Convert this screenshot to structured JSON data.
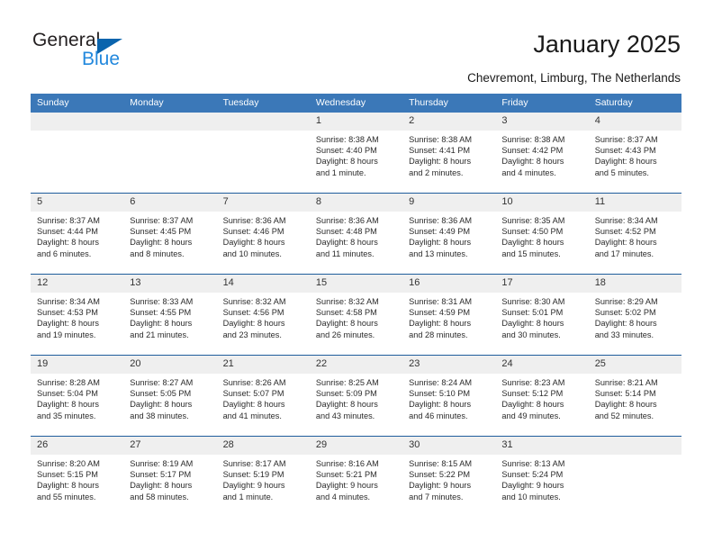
{
  "brand": {
    "name_top": "General",
    "name_bottom": "Blue",
    "accent_color": "#0a64ad",
    "accent_light": "#2288dd"
  },
  "header": {
    "title": "January 2025",
    "subtitle": "Chevremont, Limburg, The Netherlands"
  },
  "theme": {
    "header_row_bg": "#3b78b8",
    "row_divider": "#1f5d9c",
    "daynum_bg": "#efefef",
    "text": "#2b2b2b"
  },
  "weekday_headers": [
    "Sunday",
    "Monday",
    "Tuesday",
    "Wednesday",
    "Thursday",
    "Friday",
    "Saturday"
  ],
  "weeks": [
    [
      {
        "day": "",
        "empty": true,
        "sunrise": "",
        "sunset": "",
        "daylight_line1": "",
        "daylight_line2": ""
      },
      {
        "day": "",
        "empty": true,
        "sunrise": "",
        "sunset": "",
        "daylight_line1": "",
        "daylight_line2": ""
      },
      {
        "day": "",
        "empty": true,
        "sunrise": "",
        "sunset": "",
        "daylight_line1": "",
        "daylight_line2": ""
      },
      {
        "day": "1",
        "empty": false,
        "sunrise": "Sunrise: 8:38 AM",
        "sunset": "Sunset: 4:40 PM",
        "daylight_line1": "Daylight: 8 hours",
        "daylight_line2": "and 1 minute."
      },
      {
        "day": "2",
        "empty": false,
        "sunrise": "Sunrise: 8:38 AM",
        "sunset": "Sunset: 4:41 PM",
        "daylight_line1": "Daylight: 8 hours",
        "daylight_line2": "and 2 minutes."
      },
      {
        "day": "3",
        "empty": false,
        "sunrise": "Sunrise: 8:38 AM",
        "sunset": "Sunset: 4:42 PM",
        "daylight_line1": "Daylight: 8 hours",
        "daylight_line2": "and 4 minutes."
      },
      {
        "day": "4",
        "empty": false,
        "sunrise": "Sunrise: 8:37 AM",
        "sunset": "Sunset: 4:43 PM",
        "daylight_line1": "Daylight: 8 hours",
        "daylight_line2": "and 5 minutes."
      }
    ],
    [
      {
        "day": "5",
        "empty": false,
        "sunrise": "Sunrise: 8:37 AM",
        "sunset": "Sunset: 4:44 PM",
        "daylight_line1": "Daylight: 8 hours",
        "daylight_line2": "and 6 minutes."
      },
      {
        "day": "6",
        "empty": false,
        "sunrise": "Sunrise: 8:37 AM",
        "sunset": "Sunset: 4:45 PM",
        "daylight_line1": "Daylight: 8 hours",
        "daylight_line2": "and 8 minutes."
      },
      {
        "day": "7",
        "empty": false,
        "sunrise": "Sunrise: 8:36 AM",
        "sunset": "Sunset: 4:46 PM",
        "daylight_line1": "Daylight: 8 hours",
        "daylight_line2": "and 10 minutes."
      },
      {
        "day": "8",
        "empty": false,
        "sunrise": "Sunrise: 8:36 AM",
        "sunset": "Sunset: 4:48 PM",
        "daylight_line1": "Daylight: 8 hours",
        "daylight_line2": "and 11 minutes."
      },
      {
        "day": "9",
        "empty": false,
        "sunrise": "Sunrise: 8:36 AM",
        "sunset": "Sunset: 4:49 PM",
        "daylight_line1": "Daylight: 8 hours",
        "daylight_line2": "and 13 minutes."
      },
      {
        "day": "10",
        "empty": false,
        "sunrise": "Sunrise: 8:35 AM",
        "sunset": "Sunset: 4:50 PM",
        "daylight_line1": "Daylight: 8 hours",
        "daylight_line2": "and 15 minutes."
      },
      {
        "day": "11",
        "empty": false,
        "sunrise": "Sunrise: 8:34 AM",
        "sunset": "Sunset: 4:52 PM",
        "daylight_line1": "Daylight: 8 hours",
        "daylight_line2": "and 17 minutes."
      }
    ],
    [
      {
        "day": "12",
        "empty": false,
        "sunrise": "Sunrise: 8:34 AM",
        "sunset": "Sunset: 4:53 PM",
        "daylight_line1": "Daylight: 8 hours",
        "daylight_line2": "and 19 minutes."
      },
      {
        "day": "13",
        "empty": false,
        "sunrise": "Sunrise: 8:33 AM",
        "sunset": "Sunset: 4:55 PM",
        "daylight_line1": "Daylight: 8 hours",
        "daylight_line2": "and 21 minutes."
      },
      {
        "day": "14",
        "empty": false,
        "sunrise": "Sunrise: 8:32 AM",
        "sunset": "Sunset: 4:56 PM",
        "daylight_line1": "Daylight: 8 hours",
        "daylight_line2": "and 23 minutes."
      },
      {
        "day": "15",
        "empty": false,
        "sunrise": "Sunrise: 8:32 AM",
        "sunset": "Sunset: 4:58 PM",
        "daylight_line1": "Daylight: 8 hours",
        "daylight_line2": "and 26 minutes."
      },
      {
        "day": "16",
        "empty": false,
        "sunrise": "Sunrise: 8:31 AM",
        "sunset": "Sunset: 4:59 PM",
        "daylight_line1": "Daylight: 8 hours",
        "daylight_line2": "and 28 minutes."
      },
      {
        "day": "17",
        "empty": false,
        "sunrise": "Sunrise: 8:30 AM",
        "sunset": "Sunset: 5:01 PM",
        "daylight_line1": "Daylight: 8 hours",
        "daylight_line2": "and 30 minutes."
      },
      {
        "day": "18",
        "empty": false,
        "sunrise": "Sunrise: 8:29 AM",
        "sunset": "Sunset: 5:02 PM",
        "daylight_line1": "Daylight: 8 hours",
        "daylight_line2": "and 33 minutes."
      }
    ],
    [
      {
        "day": "19",
        "empty": false,
        "sunrise": "Sunrise: 8:28 AM",
        "sunset": "Sunset: 5:04 PM",
        "daylight_line1": "Daylight: 8 hours",
        "daylight_line2": "and 35 minutes."
      },
      {
        "day": "20",
        "empty": false,
        "sunrise": "Sunrise: 8:27 AM",
        "sunset": "Sunset: 5:05 PM",
        "daylight_line1": "Daylight: 8 hours",
        "daylight_line2": "and 38 minutes."
      },
      {
        "day": "21",
        "empty": false,
        "sunrise": "Sunrise: 8:26 AM",
        "sunset": "Sunset: 5:07 PM",
        "daylight_line1": "Daylight: 8 hours",
        "daylight_line2": "and 41 minutes."
      },
      {
        "day": "22",
        "empty": false,
        "sunrise": "Sunrise: 8:25 AM",
        "sunset": "Sunset: 5:09 PM",
        "daylight_line1": "Daylight: 8 hours",
        "daylight_line2": "and 43 minutes."
      },
      {
        "day": "23",
        "empty": false,
        "sunrise": "Sunrise: 8:24 AM",
        "sunset": "Sunset: 5:10 PM",
        "daylight_line1": "Daylight: 8 hours",
        "daylight_line2": "and 46 minutes."
      },
      {
        "day": "24",
        "empty": false,
        "sunrise": "Sunrise: 8:23 AM",
        "sunset": "Sunset: 5:12 PM",
        "daylight_line1": "Daylight: 8 hours",
        "daylight_line2": "and 49 minutes."
      },
      {
        "day": "25",
        "empty": false,
        "sunrise": "Sunrise: 8:21 AM",
        "sunset": "Sunset: 5:14 PM",
        "daylight_line1": "Daylight: 8 hours",
        "daylight_line2": "and 52 minutes."
      }
    ],
    [
      {
        "day": "26",
        "empty": false,
        "sunrise": "Sunrise: 8:20 AM",
        "sunset": "Sunset: 5:15 PM",
        "daylight_line1": "Daylight: 8 hours",
        "daylight_line2": "and 55 minutes."
      },
      {
        "day": "27",
        "empty": false,
        "sunrise": "Sunrise: 8:19 AM",
        "sunset": "Sunset: 5:17 PM",
        "daylight_line1": "Daylight: 8 hours",
        "daylight_line2": "and 58 minutes."
      },
      {
        "day": "28",
        "empty": false,
        "sunrise": "Sunrise: 8:17 AM",
        "sunset": "Sunset: 5:19 PM",
        "daylight_line1": "Daylight: 9 hours",
        "daylight_line2": "and 1 minute."
      },
      {
        "day": "29",
        "empty": false,
        "sunrise": "Sunrise: 8:16 AM",
        "sunset": "Sunset: 5:21 PM",
        "daylight_line1": "Daylight: 9 hours",
        "daylight_line2": "and 4 minutes."
      },
      {
        "day": "30",
        "empty": false,
        "sunrise": "Sunrise: 8:15 AM",
        "sunset": "Sunset: 5:22 PM",
        "daylight_line1": "Daylight: 9 hours",
        "daylight_line2": "and 7 minutes."
      },
      {
        "day": "31",
        "empty": false,
        "sunrise": "Sunrise: 8:13 AM",
        "sunset": "Sunset: 5:24 PM",
        "daylight_line1": "Daylight: 9 hours",
        "daylight_line2": "and 10 minutes."
      },
      {
        "day": "",
        "empty": true,
        "sunrise": "",
        "sunset": "",
        "daylight_line1": "",
        "daylight_line2": ""
      }
    ]
  ]
}
